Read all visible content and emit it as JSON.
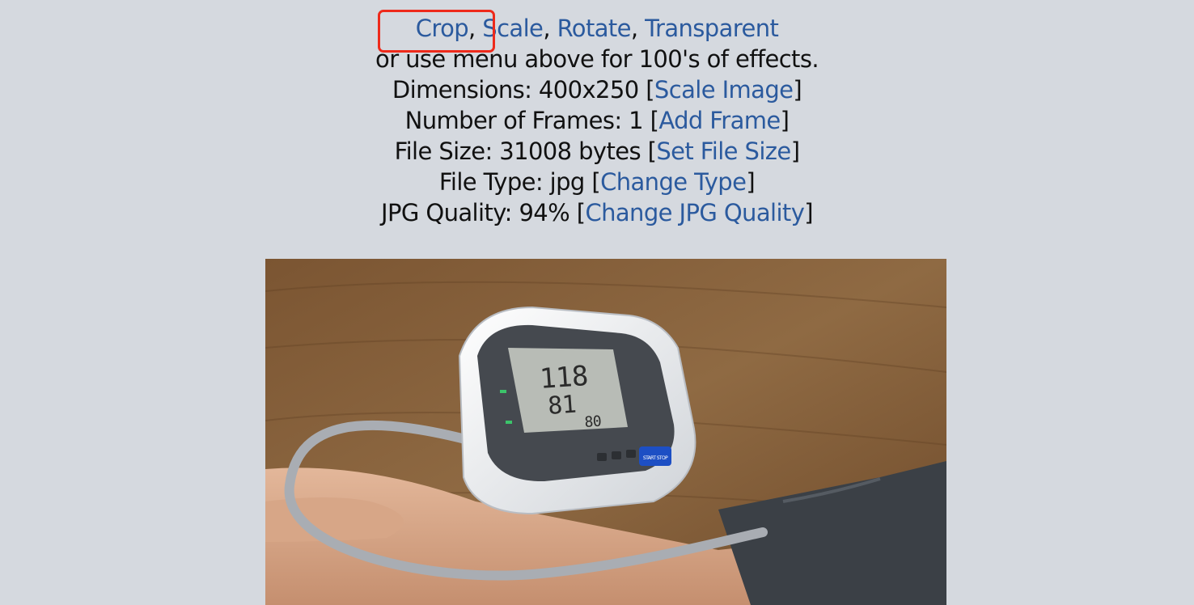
{
  "actions": {
    "crop": "Crop",
    "sep1": ", ",
    "scale": "Scale",
    "sep2": ", ",
    "rotate": "Rotate",
    "sep3": ", ",
    "transparent": "Transparent"
  },
  "menu_hint": "or use menu above for 100's of effects.",
  "dimensions": {
    "label": "Dimensions: 400x250 [",
    "link": "Scale Image",
    "close": "]"
  },
  "frames": {
    "label": "Number of Frames: 1 [",
    "link": "Add Frame",
    "close": "]"
  },
  "file_size": {
    "label": "File Size: 31008 bytes [",
    "link": "Set File Size",
    "close": "]"
  },
  "file_type": {
    "label": "File Type: jpg [",
    "link": "Change Type",
    "close": "]"
  },
  "jpg_quality": {
    "label": "JPG Quality: 94% [",
    "link": "Change JPG Quality",
    "close": "]"
  },
  "image": {
    "description_icon": "photo-blood-pressure-monitor",
    "readings": {
      "sys": "118",
      "dia": "81",
      "pulse": "80"
    },
    "button_label": "START STOP"
  },
  "colors": {
    "background": "#d5d9df",
    "link": "#2b5a9e",
    "highlight": "#ee2a1b"
  }
}
